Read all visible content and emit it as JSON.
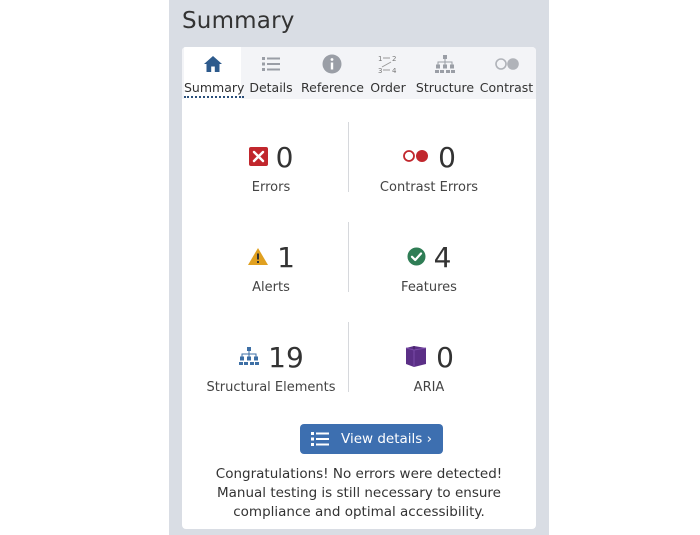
{
  "panel": {
    "title": "Summary"
  },
  "tabs": [
    {
      "label": "Summary",
      "icon": "home-icon",
      "active": true
    },
    {
      "label": "Details",
      "icon": "list-icon"
    },
    {
      "label": "Reference",
      "icon": "info-icon"
    },
    {
      "label": "Order",
      "icon": "order-icon"
    },
    {
      "label": "Structure",
      "icon": "structure-icon"
    },
    {
      "label": "Contrast",
      "icon": "contrast-icon"
    }
  ],
  "metrics": {
    "errors": {
      "value": "0",
      "label": "Errors",
      "icon": "error-x-icon",
      "color": "#c1272d"
    },
    "contrast_errors": {
      "value": "0",
      "label": "Contrast Errors",
      "icon": "contrast-error-icon",
      "color": "#c1272d"
    },
    "alerts": {
      "value": "1",
      "label": "Alerts",
      "icon": "alert-triangle-icon",
      "color": "#e0a020"
    },
    "features": {
      "value": "4",
      "label": "Features",
      "icon": "check-circle-icon",
      "color": "#2f7d55"
    },
    "structural": {
      "value": "19",
      "label": "Structural Elements",
      "icon": "structure-icon",
      "color": "#3d6fa5"
    },
    "aria": {
      "value": "0",
      "label": "ARIA",
      "icon": "aria-cube-icon",
      "color": "#5b2f86"
    }
  },
  "button": {
    "label": "View details ›",
    "icon": "list-icon"
  },
  "message": "Congratulations! No errors were detected! Manual testing is still necessary to ensure compliance and optimal accessibility."
}
